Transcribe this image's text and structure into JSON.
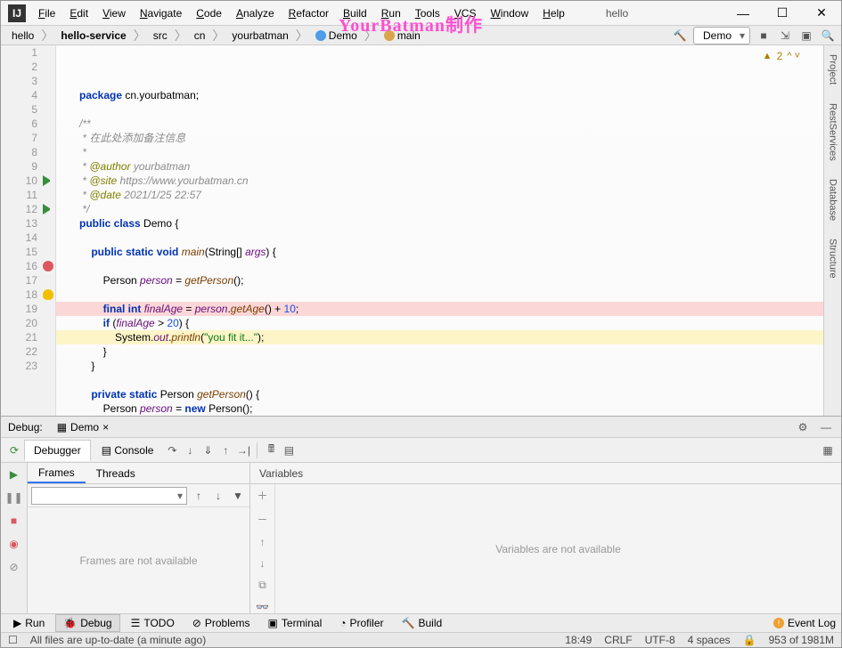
{
  "title": {
    "project": "hello"
  },
  "menu": [
    "File",
    "Edit",
    "View",
    "Navigate",
    "Code",
    "Analyze",
    "Refactor",
    "Build",
    "Run",
    "Tools",
    "VCS",
    "Window",
    "Help"
  ],
  "watermark": "YourBatman制作",
  "breadcrumbs": {
    "items": [
      "hello",
      "hello-service",
      "src",
      "cn",
      "yourbatman",
      "Demo",
      "main"
    ],
    "bold_idx": 1
  },
  "runconfig": {
    "selected": "Demo"
  },
  "editor": {
    "warnings": "2",
    "lines": [
      {
        "n": 1,
        "html": "<span class='kw'>package</span> cn.yourbatman;"
      },
      {
        "n": 2,
        "html": ""
      },
      {
        "n": 3,
        "html": "<span class='cmt'>/**</span>"
      },
      {
        "n": 4,
        "html": "<span class='cmt'> * 在此处添加备注信息</span>"
      },
      {
        "n": 5,
        "html": "<span class='cmt'> *</span>"
      },
      {
        "n": 6,
        "html": "<span class='cmt'> * <span class='ann'>@author</span> yourbatman</span>"
      },
      {
        "n": 7,
        "html": "<span class='cmt'> * <span class='ann'>@site</span> https://www.yourbatman.cn</span>"
      },
      {
        "n": 8,
        "html": "<span class='cmt'> * <span class='ann'>@date</span> 2021/1/25 22:57</span>"
      },
      {
        "n": 9,
        "html": "<span class='cmt'> */</span>"
      },
      {
        "n": 10,
        "run": true,
        "html": "<span class='kw'>public class</span> Demo {"
      },
      {
        "n": 11,
        "html": ""
      },
      {
        "n": 12,
        "run": true,
        "html": "    <span class='kw'>public static void</span> <span class='meth'>main</span>(String[] <span class='field'>args</span>) {"
      },
      {
        "n": 13,
        "html": ""
      },
      {
        "n": 14,
        "html": "        Person <span class='field'>person</span> = <span class='meth'>getPerson</span>();"
      },
      {
        "n": 15,
        "html": ""
      },
      {
        "n": 16,
        "bp": true,
        "bpline": true,
        "html": "        <span class='kw'>final int</span> <span class='field'>finalAge</span> = <span class='field'>person</span>.<span class='meth'>getAge</span>() + <span class='num'>10</span>;"
      },
      {
        "n": 17,
        "html": "        <span class='kw'>if</span> (<span class='field'>finalAge</span> > <span class='num'>20</span>) {"
      },
      {
        "n": 18,
        "bulb": true,
        "cur": true,
        "html": "            System.<span class='field'>out</span>.<span class='meth'>println</span>(<span class='str'>\"you fit it...\"</span>);"
      },
      {
        "n": 19,
        "html": "        }"
      },
      {
        "n": 20,
        "html": "    }"
      },
      {
        "n": 21,
        "html": ""
      },
      {
        "n": 22,
        "html": "    <span class='kw'>private static</span> Person <span class='meth'>getPerson</span>() {"
      },
      {
        "n": 23,
        "html": "        Person <span class='field'>person</span> = <span class='kw'>new</span> Person();"
      }
    ]
  },
  "right_tabs": [
    "Project",
    "RestServices",
    "Database",
    "Structure"
  ],
  "debug": {
    "label": "Debug:",
    "config": "Demo",
    "tabs": {
      "debugger": "Debugger",
      "console": "Console"
    },
    "frames": {
      "title_frames": "Frames",
      "title_threads": "Threads",
      "empty": "Frames are not available"
    },
    "vars": {
      "title": "Variables",
      "empty": "Variables are not available"
    }
  },
  "bottom_tabs": {
    "run": "Run",
    "debug": "Debug",
    "todo": "TODO",
    "problems": "Problems",
    "terminal": "Terminal",
    "profiler": "Profiler",
    "build": "Build",
    "event": "Event Log"
  },
  "status": {
    "msg": "All files are up-to-date (a minute ago)",
    "pos": "18:49",
    "eol": "CRLF",
    "enc": "UTF-8",
    "indent": "4 spaces",
    "mem": "953 of 1981M"
  }
}
